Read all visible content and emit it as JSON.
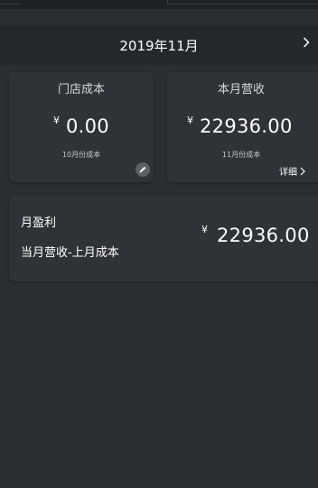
{
  "header": {
    "month_label": "2019年11月"
  },
  "cost_card": {
    "title": "门店成本",
    "currency": "¥",
    "amount": "0.00",
    "caption": "10月份成本"
  },
  "revenue_card": {
    "title": "本月营收",
    "currency": "¥",
    "amount": "22936.00",
    "caption": "11月份成本",
    "detail_label": "详细"
  },
  "profit_card": {
    "title": "月盈利",
    "formula": "当月营收-上月成本",
    "currency": "¥",
    "amount": "22936.00"
  },
  "icons": {
    "next_month": "chevron-right-icon",
    "edit": "pencil-icon",
    "detail": "chevron-right-icon"
  },
  "colors": {
    "background": "#2b2e32",
    "card": "#2f3236",
    "text": "#ffffff"
  }
}
